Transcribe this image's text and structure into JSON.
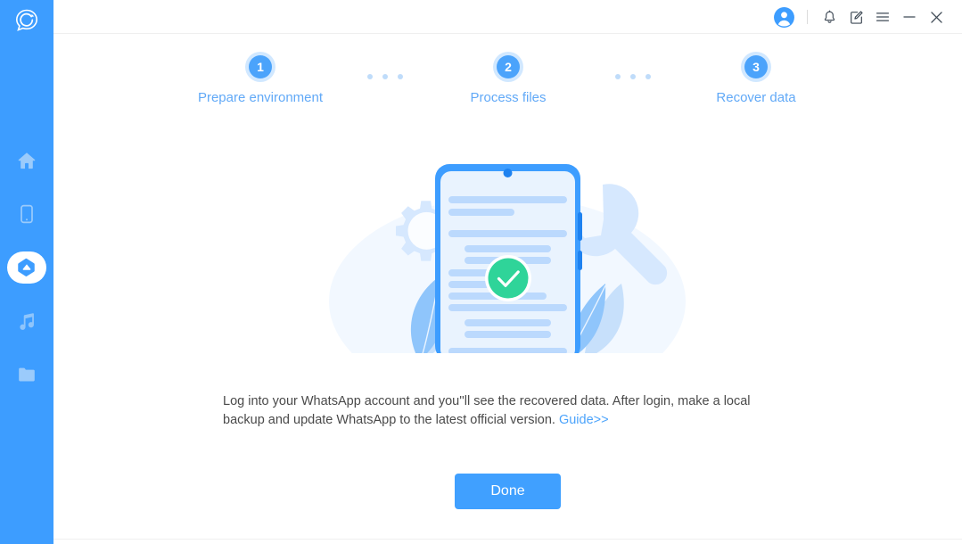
{
  "app": {
    "brand_logo_icon": "chat-refresh-logo-icon",
    "sidebar_color": "#3D9DFF",
    "accent_color": "#40A0FF"
  },
  "sidebar": {
    "items": [
      {
        "name": "home",
        "icon": "home-icon",
        "active": false
      },
      {
        "name": "device",
        "icon": "phone-icon",
        "active": false
      },
      {
        "name": "recover",
        "icon": "cloud-recover-icon",
        "active": true
      },
      {
        "name": "music",
        "icon": "music-note-icon",
        "active": false
      },
      {
        "name": "files",
        "icon": "folder-icon",
        "active": false
      }
    ]
  },
  "titlebar": {
    "buttons": [
      {
        "name": "account",
        "icon": "user-avatar-icon"
      },
      {
        "name": "notifications",
        "icon": "bell-icon"
      },
      {
        "name": "feedback",
        "icon": "note-edit-icon"
      },
      {
        "name": "menu",
        "icon": "hamburger-menu-icon"
      },
      {
        "name": "minimize",
        "icon": "minimize-icon"
      },
      {
        "name": "close",
        "icon": "close-icon"
      }
    ]
  },
  "steps": [
    {
      "number": "1",
      "label": "Prepare environment"
    },
    {
      "number": "2",
      "label": "Process files"
    },
    {
      "number": "3",
      "label": "Recover data"
    }
  ],
  "illustration": {
    "name": "phone-document-success-illustration",
    "badge_icon": "green-check-circle-icon",
    "gear_icon": "gear-icon",
    "wrench_icon": "wrench-icon",
    "check_color": "#2FD499",
    "phone_frame_color": "#3D9DFF"
  },
  "main": {
    "description_part_1": "Log into your WhatsApp account and you''ll see the recovered data. After login, make a local backup and update WhatsApp to the latest official version. ",
    "guide_link_label": "Guide>>",
    "done_label": "Done"
  }
}
